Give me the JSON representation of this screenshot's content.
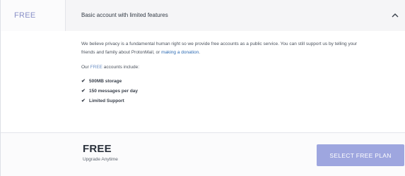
{
  "header": {
    "plan_name": "FREE",
    "summary": "Basic account with limited features"
  },
  "body": {
    "intro_text": "We believe privacy is a fundamental human right so we provide free accounts as a public service. You can still support us by telling your friends and family about ProtonMail, or",
    "donation_link": "making a donation",
    "intro_end": ".",
    "includes_prefix": "Our ",
    "includes_free": "FREE",
    "includes_suffix": " accounts include:",
    "features": [
      "500MB storage",
      "150 messages per day",
      "Limited Support"
    ]
  },
  "footer": {
    "title": "FREE",
    "subtitle": "Upgrade Anytime",
    "button_label": "SELECT FREE PLAN"
  },
  "icons": {
    "check": "checkmark-icon",
    "chevron": "chevron-up-icon"
  },
  "colors": {
    "accent": "#8a90c7",
    "button": "#9ea6df",
    "link": "#2d6bb3"
  }
}
